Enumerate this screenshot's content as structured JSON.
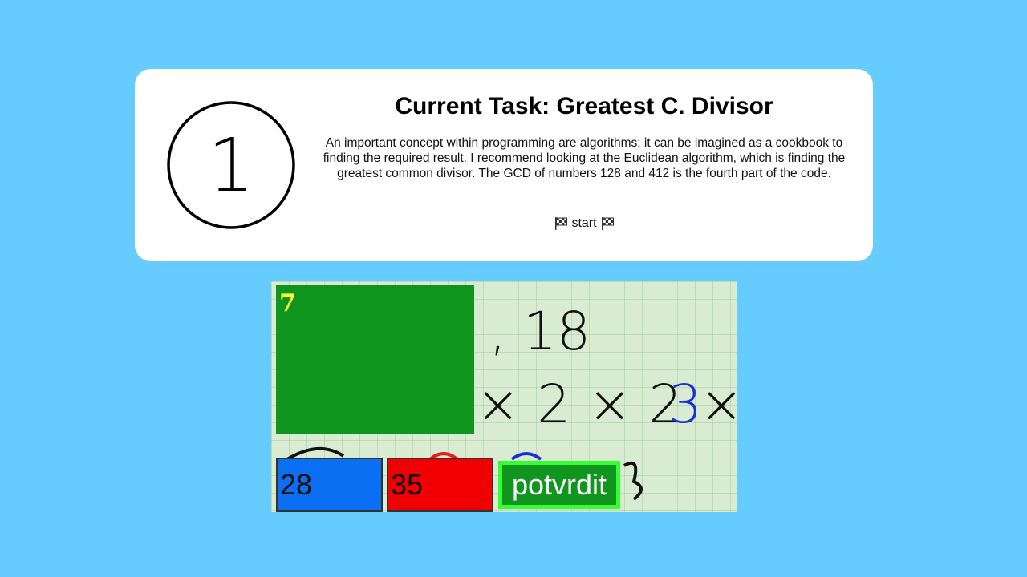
{
  "task": {
    "step_number": "1",
    "title": "Current Task: Greatest C. Divisor",
    "description": "An important concept within programming are algorithms; it can be imagined as a cookbook to finding the required result. I recommend looking at the Euclidean algorithm, which is finding the greatest common divisor. The GCD of numbers 128 and 412 is the fourth part of the code.",
    "start_label": "start",
    "start_icon": "checkered-flag-icon"
  },
  "game": {
    "background_math": {
      "line1": ", 18",
      "line2": "× 2 × 2 ×",
      "line2_blue": "3"
    },
    "target_value": "7",
    "tiles": [
      {
        "label": "28",
        "color": "#0a6ff2"
      },
      {
        "label": "35",
        "color": "#f00000"
      }
    ],
    "submit_label": "potvrdit"
  },
  "colors": {
    "page_bg": "#66ccff",
    "card_bg": "#ffffff",
    "target_green": "#10951f",
    "target_text": "#ffff2e",
    "submit_border": "#33ff33"
  }
}
